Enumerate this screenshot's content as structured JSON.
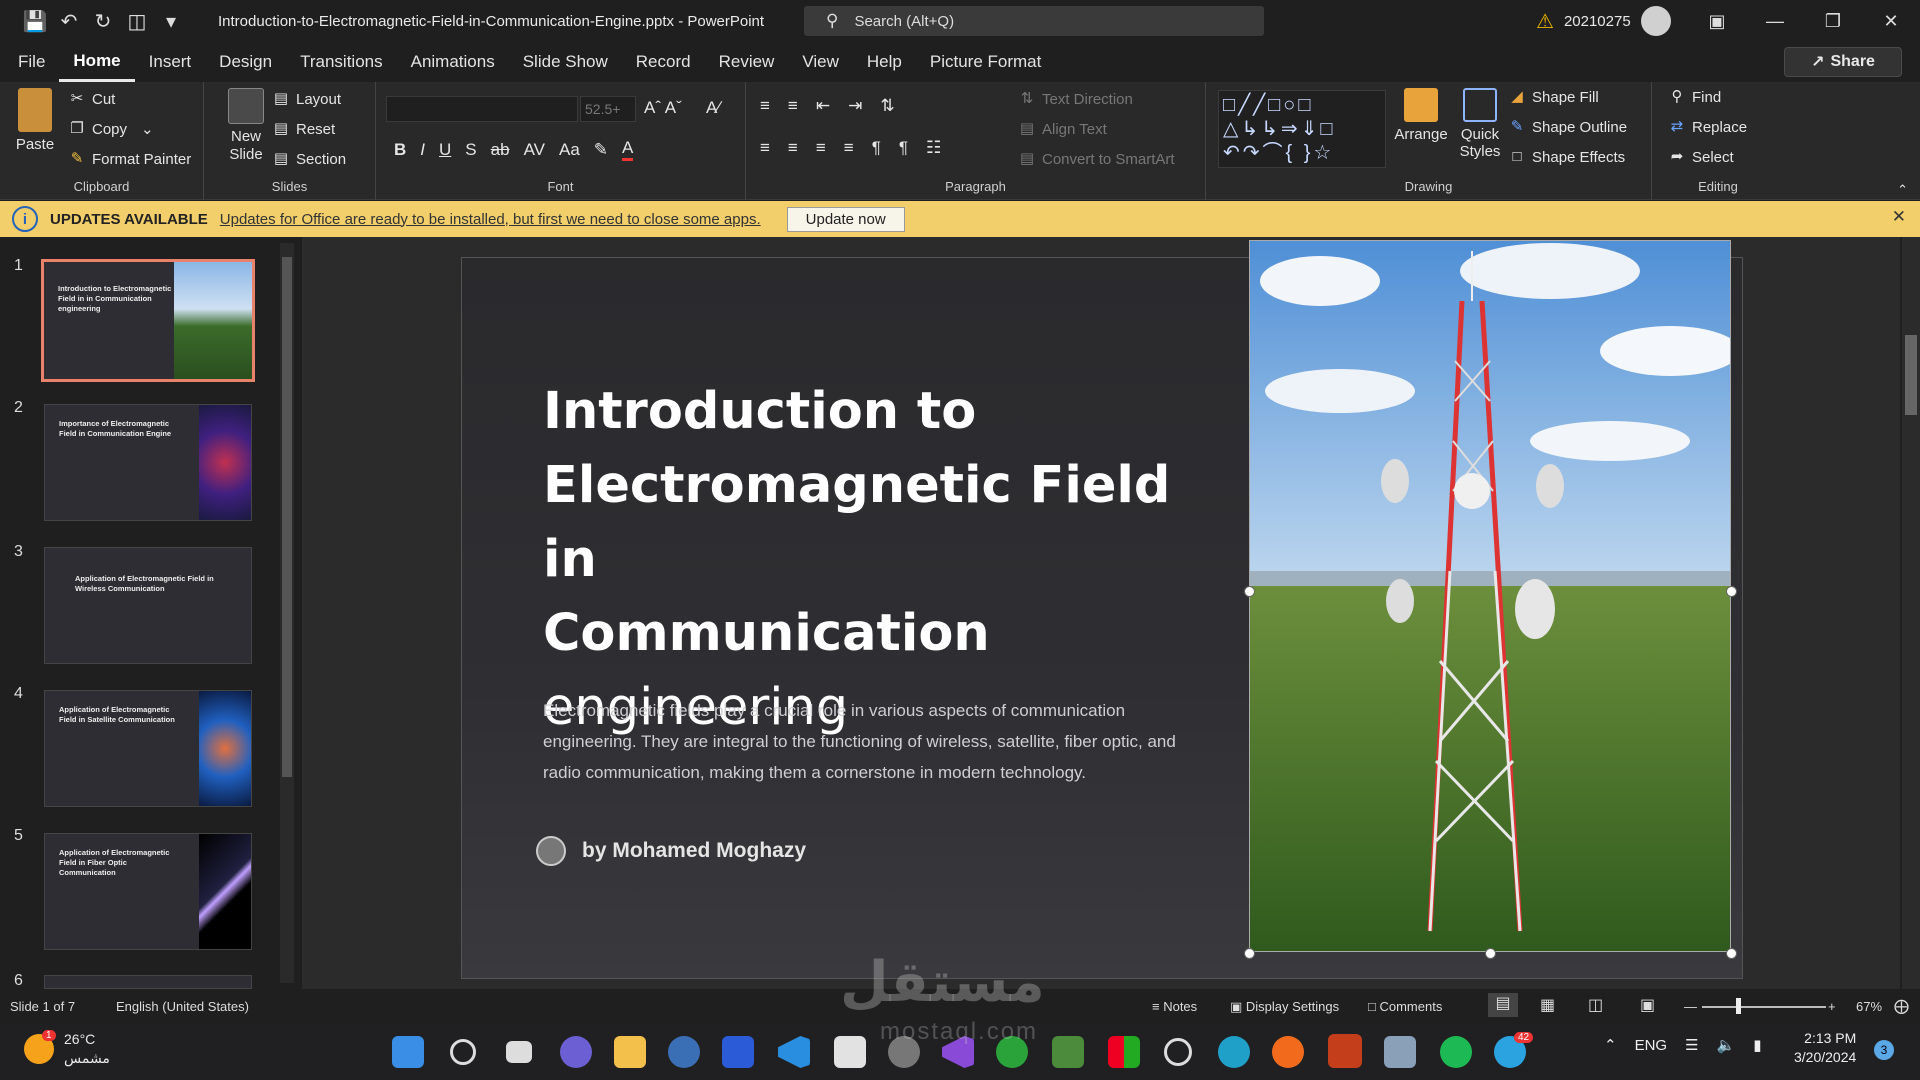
{
  "app": {
    "document_title": "Introduction-to-Electromagnetic-Field-in-Communication-Engine.pptx  -  PowerPoint",
    "search_placeholder": "Search (Alt+Q)",
    "user_id": "20210275"
  },
  "menu": {
    "items": [
      "File",
      "Home",
      "Insert",
      "Design",
      "Transitions",
      "Animations",
      "Slide Show",
      "Record",
      "Review",
      "View",
      "Help",
      "Picture Format"
    ],
    "active": "Home",
    "share_label": "Share"
  },
  "ribbon": {
    "clipboard": {
      "label": "Clipboard",
      "paste": "Paste",
      "cut": "Cut",
      "copy": "Copy",
      "format_painter": "Format Painter"
    },
    "slides": {
      "label": "Slides",
      "new_slide": "New Slide",
      "layout": "Layout",
      "reset": "Reset",
      "section": "Section"
    },
    "font": {
      "label": "Font",
      "font_size": "52.5+"
    },
    "paragraph": {
      "label": "Paragraph",
      "text_direction": "Text Direction",
      "align_text": "Align Text",
      "convert_smartart": "Convert to SmartArt"
    },
    "drawing": {
      "label": "Drawing",
      "arrange": "Arrange",
      "quick_styles": "Quick Styles",
      "shape_fill": "Shape Fill",
      "shape_outline": "Shape Outline",
      "shape_effects": "Shape Effects"
    },
    "editing": {
      "label": "Editing",
      "find": "Find",
      "replace": "Replace",
      "select": "Select"
    }
  },
  "update_bar": {
    "title": "UPDATES AVAILABLE",
    "message": "Updates for Office are ready to be installed, but first we need to close some apps.",
    "button": "Update now"
  },
  "thumbnails": [
    {
      "num": "1",
      "title": "Introduction to Electromagnetic Field in in Communication engineering",
      "selected": true
    },
    {
      "num": "2",
      "title": "Importance of Electromagnetic Field in Communication Engine"
    },
    {
      "num": "3",
      "title": "Application of Electromagnetic Field in Wireless Communication"
    },
    {
      "num": "4",
      "title": "Application of Electromagnetic Field in Satellite Communication"
    },
    {
      "num": "5",
      "title": "Application of Electromagnetic Field in Fiber Optic Communication"
    },
    {
      "num": "6",
      "title": ""
    }
  ],
  "slide": {
    "title_lines": [
      "Introduction to",
      "Electromagnetic Field in",
      "Communication"
    ],
    "title_last": "engineering",
    "body": "Electromagnetic fields play a crucial role in various aspects of communication engineering. They are integral to the functioning of wireless, satellite, fiber optic, and radio communication, making them a cornerstone in modern technology.",
    "author": "by Mohamed Moghazy"
  },
  "status": {
    "slide_count": "Slide 1 of 7",
    "language": "English (United States)",
    "notes": "Notes",
    "display_settings": "Display Settings",
    "comments": "Comments",
    "zoom": "67%"
  },
  "taskbar": {
    "temperature": "26°C",
    "weather": "مشمس",
    "lang": "ENG",
    "time": "2:13 PM",
    "date": "3/20/2024",
    "notifications": "3",
    "telegram_badge": "42",
    "weather_badge": "1"
  },
  "watermark": {
    "arabic": "مستقل",
    "latin": "mostaql.com"
  },
  "colors": {
    "accent_selected": "#e9826b",
    "update_bar": "#f2cf6b",
    "ppt_red": "#c43e1c"
  }
}
